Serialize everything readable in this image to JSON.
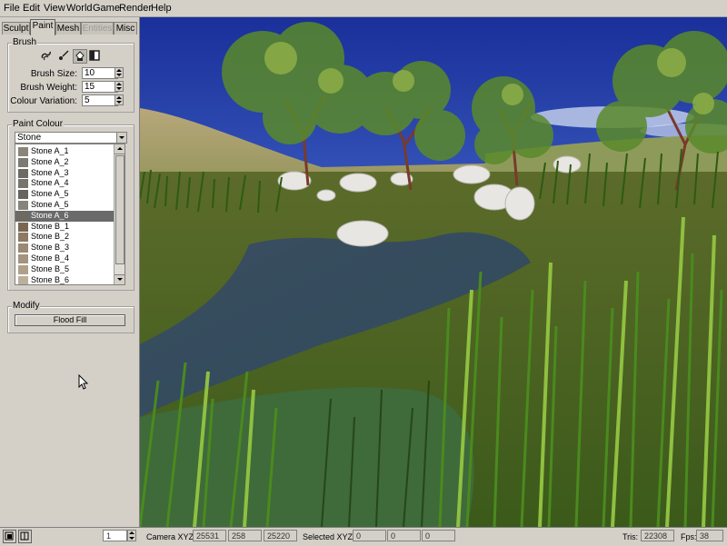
{
  "menu": [
    "File",
    "Edit",
    "View",
    "World",
    "Game",
    "Render",
    "Help"
  ],
  "tabs": [
    {
      "label": "Sculpt",
      "state": "normal"
    },
    {
      "label": "Paint",
      "state": "active"
    },
    {
      "label": "Mesh",
      "state": "normal"
    },
    {
      "label": "Entities",
      "state": "disabled"
    },
    {
      "label": "Misc",
      "state": "normal"
    }
  ],
  "brush": {
    "title": "Brush",
    "tools": [
      "smudge-icon",
      "paint-brush-icon",
      "fill-bucket-icon",
      "square-icon"
    ],
    "size_label": "Brush Size:",
    "size_value": "10",
    "weight_label": "Brush Weight:",
    "weight_value": "15",
    "variation_label": "Colour Variation:",
    "variation_value": "5"
  },
  "paint_colour": {
    "title": "Paint Colour",
    "category": "Stone",
    "items": [
      {
        "label": "Stone A_1",
        "color": "#8a8579"
      },
      {
        "label": "Stone A_2",
        "color": "#7c7a72"
      },
      {
        "label": "Stone A_3",
        "color": "#6b6a64"
      },
      {
        "label": "Stone A_4",
        "color": "#77746c"
      },
      {
        "label": "Stone A_5",
        "color": "#66645e"
      },
      {
        "label": "Stone A_5",
        "color": "#87847b"
      },
      {
        "label": "Stone A_6",
        "color": "#6e6a60",
        "selected": true
      },
      {
        "label": "Stone B_1",
        "color": "#7a6650"
      },
      {
        "label": "Stone B_2",
        "color": "#8e7a62"
      },
      {
        "label": "Stone B_3",
        "color": "#9a8a74"
      },
      {
        "label": "Stone B_4",
        "color": "#a39380"
      },
      {
        "label": "Stone B_5",
        "color": "#b0a08a"
      },
      {
        "label": "Stone B_6",
        "color": "#bcaf9a"
      }
    ]
  },
  "modify": {
    "title": "Modify",
    "flood_fill_label": "Flood Fill"
  },
  "status": {
    "frame_value": "1",
    "camera_label": "Camera XYZ:",
    "camera": [
      "25531",
      "258",
      "25220"
    ],
    "selected_label": "Selected XYZ:",
    "selected": [
      "0",
      "0",
      "0"
    ],
    "tris_label": "Tris:",
    "tris_value": "22308",
    "fps_label": "Fps:",
    "fps_value": "38"
  }
}
